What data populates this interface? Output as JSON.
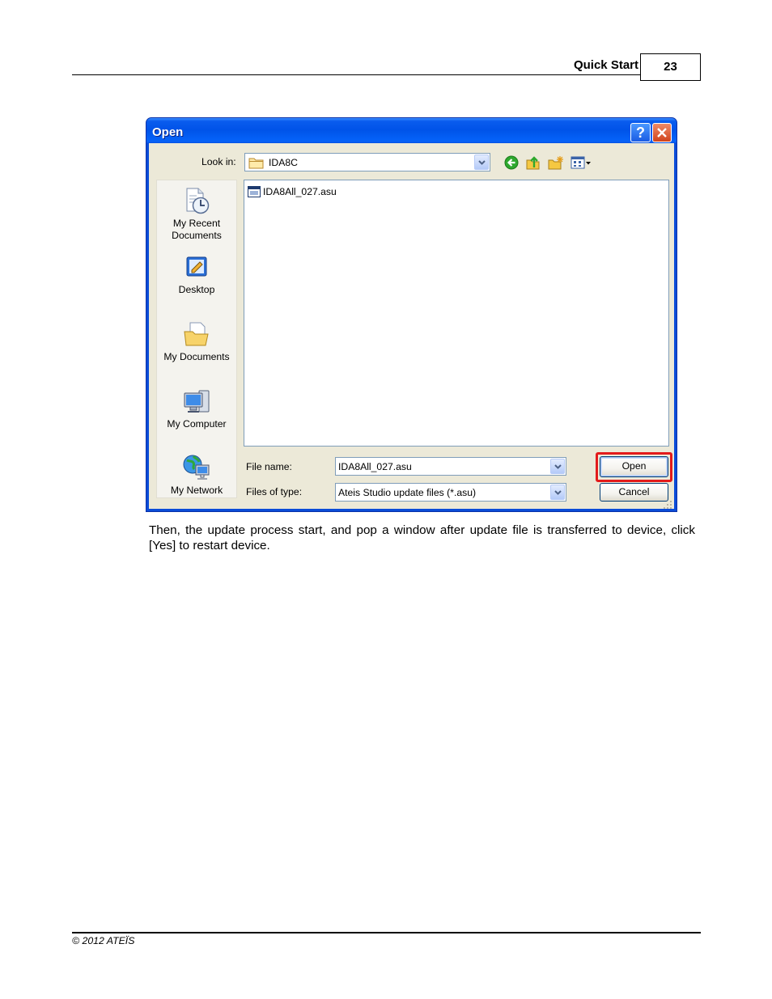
{
  "header": {
    "section_title": "Quick Start",
    "page_number": "23"
  },
  "dialog": {
    "title": "Open",
    "title_bar": {
      "help_glyph": "?",
      "help_icon": "help-icon",
      "close_icon": "close-icon"
    },
    "look_in": {
      "label": "Look in:",
      "value": "IDA8C",
      "icon": "folder-icon"
    },
    "toolbar": [
      {
        "icon": "back-icon"
      },
      {
        "icon": "up-one-level-icon"
      },
      {
        "icon": "new-folder-icon"
      },
      {
        "icon": "views-menu-icon"
      }
    ],
    "places": [
      {
        "icon": "my-recent-documents-icon",
        "lines": [
          "My Recent",
          "Documents"
        ]
      },
      {
        "icon": "desktop-icon",
        "lines": [
          "Desktop"
        ]
      },
      {
        "icon": "my-documents-icon",
        "lines": [
          "My Documents"
        ]
      },
      {
        "icon": "my-computer-icon",
        "lines": [
          "My Computer"
        ]
      },
      {
        "icon": "my-network-icon",
        "lines": [
          "My Network"
        ]
      }
    ],
    "files": [
      {
        "name": "IDA8All_027.asu",
        "icon": "asu-file-icon"
      }
    ],
    "file_name": {
      "label": "File name:",
      "value": "IDA8All_027.asu"
    },
    "file_type": {
      "label": "Files of type:",
      "value": "Ateis Studio update files (*.asu)"
    },
    "buttons": {
      "open": "Open",
      "cancel": "Cancel"
    },
    "colors": {
      "title_bar": "#0053E8",
      "face": "#ECE9D8",
      "highlight": "#E31B1B"
    }
  },
  "body_text": "Then, the update process start,  and pop a window after update file is transferred to device, click [Yes] to restart device.",
  "footer": {
    "copyright": "© 2012 ATEÏS"
  }
}
